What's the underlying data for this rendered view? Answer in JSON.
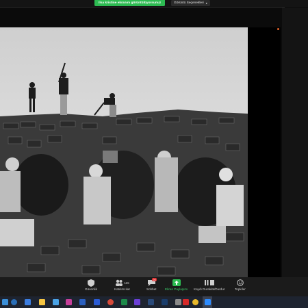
{
  "share_banner": {
    "status_text": "Ilsa kristine ekranını görüntülüyorsunuz",
    "view_options_label": "Görüntü Seçenekleri"
  },
  "shared_image": {
    "description_icon": "photo-icon"
  },
  "controls": {
    "security_label": "Güvenlik",
    "participants_label": "Katılımcılar",
    "participants_count": "115",
    "chat_label": "Sohbet",
    "chat_badge": "26",
    "share_label": "Ekran Paylaşımı",
    "record_label": "Kaydı Duraklat/Durdur",
    "reactions_label": "Tepkiler"
  },
  "colors": {
    "share_green": "#2dbb52",
    "badge_red": "#e02d2d",
    "taskbar_bg": "#1e2430"
  },
  "taskbar": {
    "icons": [
      "windows-icon",
      "search-icon",
      "calendar-icon",
      "folder-icon",
      "mail-icon",
      "store-icon",
      "photos-icon",
      "word-icon",
      "chrome-icon",
      "excel-icon",
      "video-icon",
      "lightroom-icon",
      "photoshop-icon",
      "settings-icon",
      "acrobat-icon",
      "chrome-icon",
      "opera-icon",
      "zoom-icon"
    ]
  }
}
